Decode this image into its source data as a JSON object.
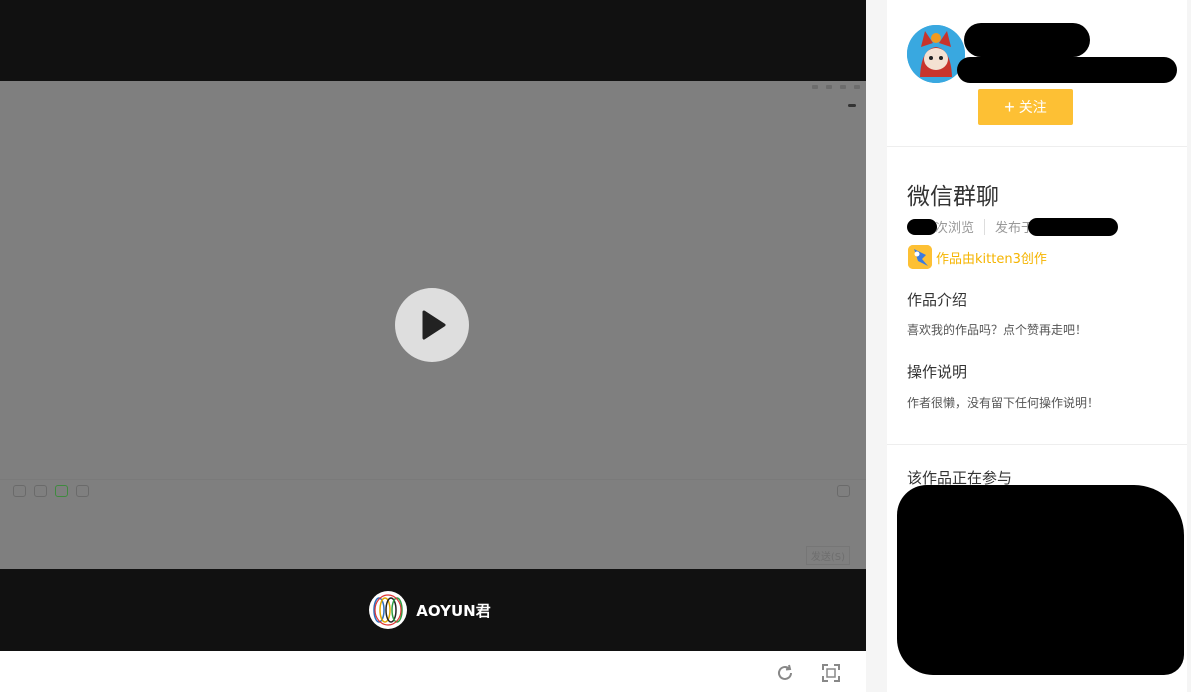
{
  "player": {
    "author_name": "AOYUN君",
    "stage": {
      "send_button_label": "发送(S)"
    }
  },
  "toolbar": {
    "restart": "refresh-icon",
    "fullscreen": "fullscreen-icon"
  },
  "sidebar": {
    "follow_label": "关注",
    "work": {
      "title": "微信群聊",
      "views_suffix": "次浏览",
      "published_prefix": "发布于",
      "created_with": "作品由kitten3创作",
      "intro_title": "作品介绍",
      "intro_text": "喜欢我的作品吗？点个赞再走吧！",
      "instructions_title": "操作说明",
      "instructions_text": "作者很懒，没有留下任何操作说明！"
    },
    "event_label": "该作品正在参与"
  },
  "colors": {
    "accent": "#fdc034",
    "player_bg": "#111111",
    "stage_bg": "#7f7f7f"
  }
}
